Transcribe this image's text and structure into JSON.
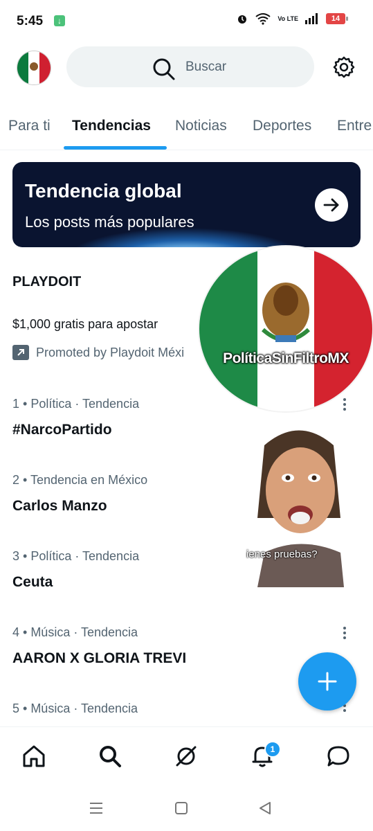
{
  "status_bar": {
    "time": "5:45",
    "network": "Vo LTE",
    "battery": "14"
  },
  "search": {
    "placeholder": "Buscar"
  },
  "tabs": [
    {
      "label": "Para ti"
    },
    {
      "label": "Tendencias",
      "active": true
    },
    {
      "label": "Noticias"
    },
    {
      "label": "Deportes"
    },
    {
      "label": "Entre"
    }
  ],
  "banner": {
    "title": "Tendencia global",
    "subtitle": "Los posts más populares"
  },
  "promoted": {
    "title": "PLAYDOIT",
    "description": "$1,000 gratis para apostar",
    "by": "Promoted by Playdoit Méxi"
  },
  "trends": [
    {
      "meta": "1 • Política · Tendencia",
      "name": "#NarcoPartido"
    },
    {
      "meta": "2 • Tendencia en México",
      "name": "Carlos Manzo"
    },
    {
      "meta": "3 • Política · Tendencia",
      "name": "Ceuta"
    },
    {
      "meta": "4 • Música · Tendencia",
      "name": "AARON X GLORIA TREVI"
    },
    {
      "meta": "5 • Música · Tendencia",
      "name": ""
    }
  ],
  "stickers": {
    "watermark": "PolíticaSinFiltroMX",
    "caption": "ienes pruebas?"
  },
  "notifications": {
    "count": "1"
  },
  "colors": {
    "accent": "#1d9bf0",
    "text": "#0f1419",
    "secondary": "#536471"
  }
}
